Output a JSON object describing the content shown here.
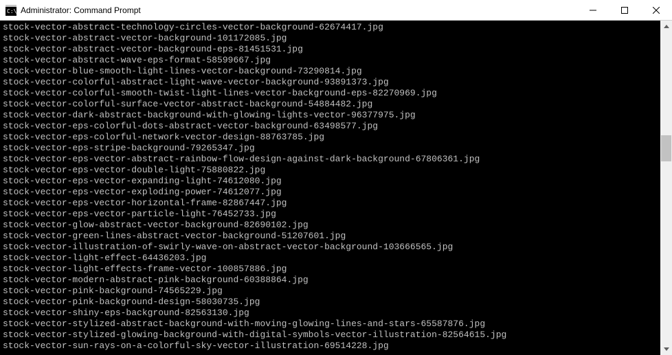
{
  "window": {
    "title": "Administrator: Command Prompt"
  },
  "terminal": {
    "lines": [
      "stock-vector-abstract-technology-circles-vector-background-62674417.jpg",
      "stock-vector-abstract-vector-background-101172085.jpg",
      "stock-vector-abstract-vector-background-eps-81451531.jpg",
      "stock-vector-abstract-wave-eps-format-58599667.jpg",
      "stock-vector-blue-smooth-light-lines-vector-background-73290814.jpg",
      "stock-vector-colorful-abstract-light-wave-vector-background-93891373.jpg",
      "stock-vector-colorful-smooth-twist-light-lines-vector-background-eps-82270969.jpg",
      "stock-vector-colorful-surface-vector-abstract-background-54884482.jpg",
      "stock-vector-dark-abstract-background-with-glowing-lights-vector-96377975.jpg",
      "stock-vector-eps-colorful-dots-abstract-vector-background-63498577.jpg",
      "stock-vector-eps-colorful-network-vector-design-88763785.jpg",
      "stock-vector-eps-stripe-background-79265347.jpg",
      "stock-vector-eps-vector-abstract-rainbow-flow-design-against-dark-background-67806361.jpg",
      "stock-vector-eps-vector-double-light-75880822.jpg",
      "stock-vector-eps-vector-expanding-light-74612080.jpg",
      "stock-vector-eps-vector-exploding-power-74612077.jpg",
      "stock-vector-eps-vector-horizontal-frame-82867447.jpg",
      "stock-vector-eps-vector-particle-light-76452733.jpg",
      "stock-vector-glow-abstract-vector-background-82690102.jpg",
      "stock-vector-green-lines-abstract-vector-background-51207601.jpg",
      "stock-vector-illustration-of-swirly-wave-on-abstract-vector-background-103666565.jpg",
      "stock-vector-light-effect-64436203.jpg",
      "stock-vector-light-effects-frame-vector-100857886.jpg",
      "stock-vector-modern-abstract-pink-background-60388864.jpg",
      "stock-vector-pink-background-74565229.jpg",
      "stock-vector-pink-background-design-58030735.jpg",
      "stock-vector-shiny-eps-background-82563130.jpg",
      "stock-vector-stylized-abstract-background-with-moving-glowing-lines-and-stars-65587876.jpg",
      "stock-vector-stylized-glowing-background-with-digital-symbols-vector-illustration-82564615.jpg",
      "stock-vector-sun-rays-on-a-colorful-sky-vector-illustration-69514228.jpg"
    ]
  }
}
